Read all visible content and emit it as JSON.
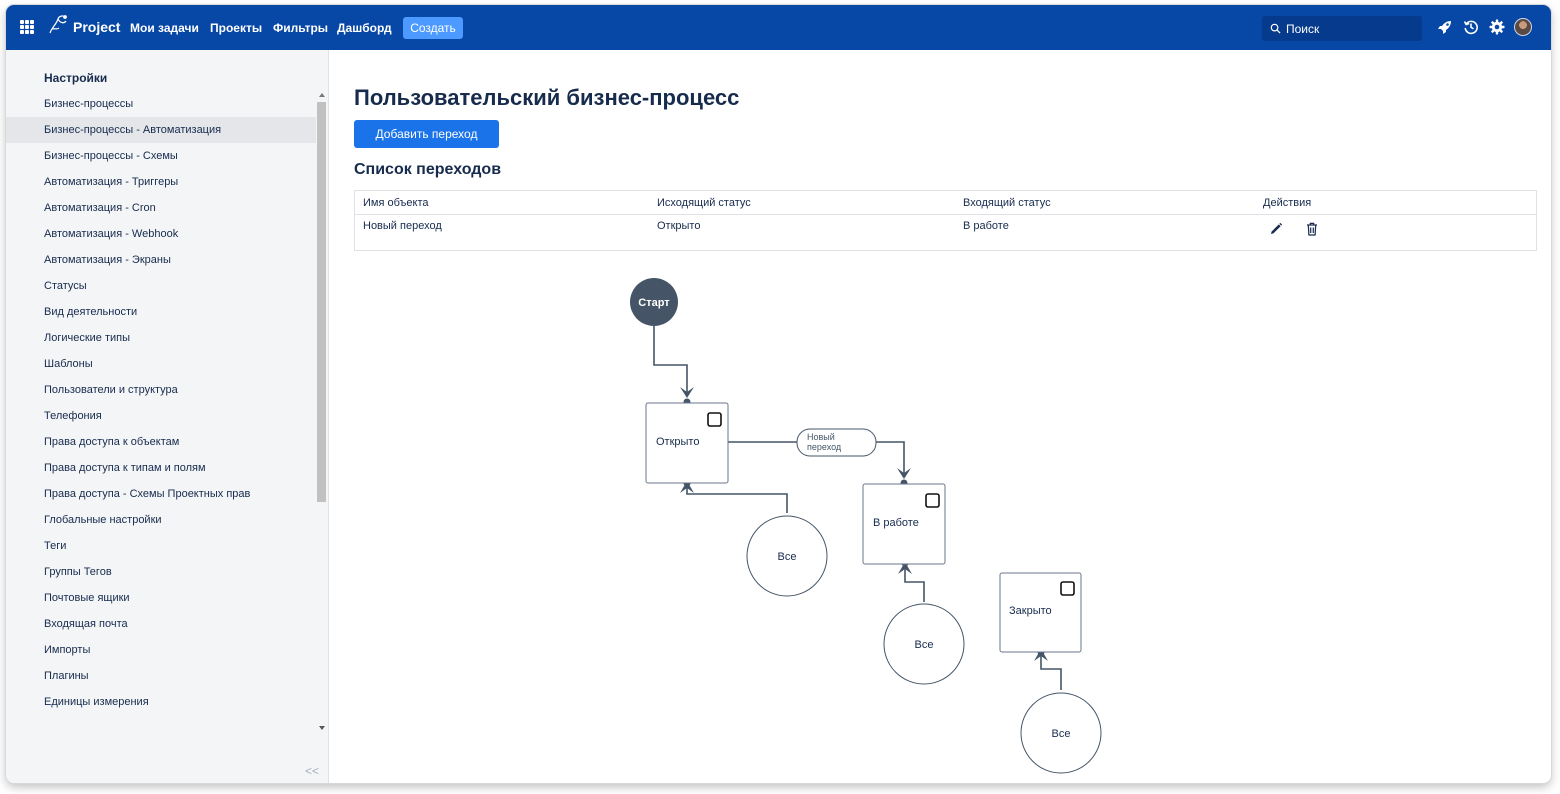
{
  "topbar": {
    "brand": "Project",
    "nav": [
      "Мои задачи",
      "Проекты",
      "Фильтры",
      "Дашборд"
    ],
    "create_label": "Создать",
    "search_placeholder": "Поиск",
    "icons": [
      "apps-grid-icon",
      "project-logo-icon",
      "search-icon",
      "rocket-icon",
      "history-icon",
      "gear-icon",
      "user-avatar"
    ]
  },
  "sidebar": {
    "title": "Настройки",
    "items": [
      {
        "label": "Бизнес-процессы"
      },
      {
        "label": "Бизнес-процессы - Автоматизация",
        "active": true
      },
      {
        "label": "Бизнес-процессы - Схемы"
      },
      {
        "label": "Автоматизация - Триггеры"
      },
      {
        "label": "Автоматизация - Cron"
      },
      {
        "label": "Автоматизация - Webhook"
      },
      {
        "label": "Автоматизация - Экраны"
      },
      {
        "label": "Статусы"
      },
      {
        "label": "Вид деятельности"
      },
      {
        "label": "Логические типы"
      },
      {
        "label": "Шаблоны"
      },
      {
        "label": "Пользователи и структура"
      },
      {
        "label": "Телефония"
      },
      {
        "label": "Права доступа к объектам"
      },
      {
        "label": "Права доступа к типам и полям"
      },
      {
        "label": "Права доступа - Схемы Проектных прав"
      },
      {
        "label": "Глобальные настройки"
      },
      {
        "label": "Теги"
      },
      {
        "label": "Группы Тегов"
      },
      {
        "label": "Почтовые ящики"
      },
      {
        "label": "Входящая почта"
      },
      {
        "label": "Импорты"
      },
      {
        "label": "Плагины"
      },
      {
        "label": "Единицы измерения"
      }
    ],
    "collapse_label": "<<"
  },
  "main": {
    "title": "Пользовательский бизнес-процесс",
    "add_button": "Добавить переход",
    "section_title": "Список переходов",
    "table": {
      "headers": [
        "Имя объекта",
        "Исходящий статус",
        "Входящий статус",
        "Действия"
      ],
      "rows": [
        {
          "name": "Новый переход",
          "from": "Открыто",
          "to": "В работе",
          "actions": [
            "edit-pencil-icon",
            "delete-trash-icon"
          ]
        }
      ]
    },
    "diagram": {
      "start_label": "Старт",
      "statuses": [
        "Открыто",
        "В работе",
        "Закрыто"
      ],
      "transition_label": [
        "Новый",
        "переход"
      ],
      "all_label": "Все",
      "colors": {
        "start_fill": "#455567",
        "stroke": "#455567",
        "node_stroke": "#6b778c"
      }
    }
  }
}
